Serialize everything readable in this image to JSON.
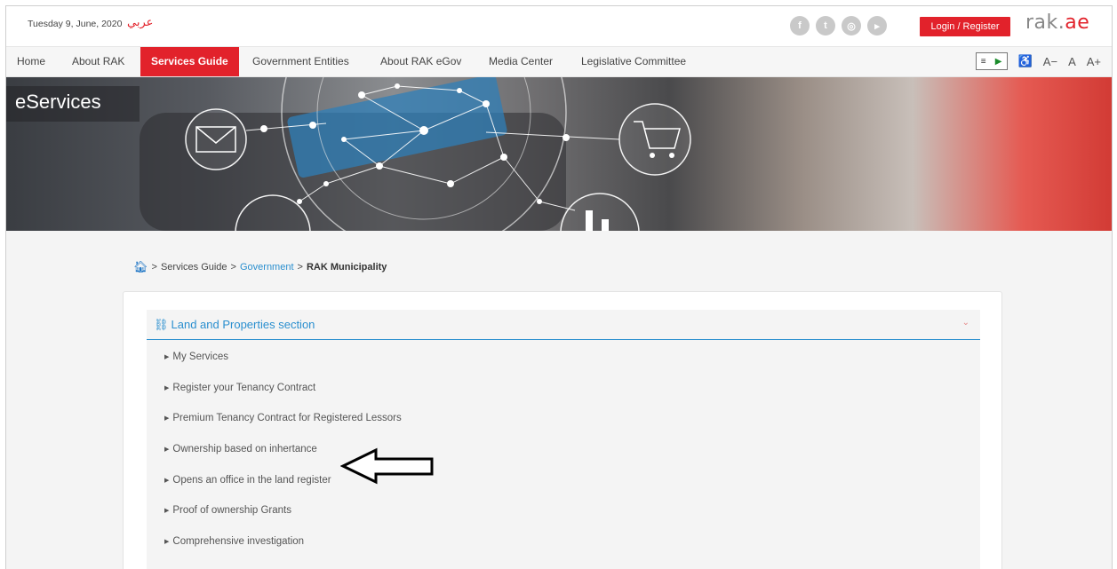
{
  "topbar": {
    "date": "Tuesday 9, June, 2020",
    "language_switch": "عربي",
    "social": [
      {
        "icon": "facebook-icon",
        "glyph": "f"
      },
      {
        "icon": "twitter-icon",
        "glyph": "t"
      },
      {
        "icon": "instagram-icon",
        "glyph": "◎"
      },
      {
        "icon": "youtube-icon",
        "glyph": "▸"
      }
    ],
    "login_label": "Login / Register",
    "brand_left": "rak.",
    "brand_right": "ae"
  },
  "nav": {
    "items": [
      "Home",
      "About RAK",
      "Services Guide",
      "Government Entities",
      "About RAK eGov",
      "Media Center",
      "Legislative Committee"
    ],
    "active_index": 2,
    "font_small": "A−",
    "font_normal": "A",
    "font_large": "A+"
  },
  "hero": {
    "title": "eServices"
  },
  "breadcrumb": {
    "sep": ">",
    "services_guide": "Services Guide",
    "government": "Government",
    "current": "RAK Municipality"
  },
  "section": {
    "title": "Land and Properties section",
    "items": [
      "My Services",
      "Register your Tenancy Contract",
      "Premium Tenancy Contract for Registered Lessors",
      "Ownership based on inhertance",
      "Opens an office in the land register",
      "Proof of ownership Grants",
      "Comprehensive investigation"
    ]
  },
  "colors": {
    "brand_red": "#e2222b",
    "link_blue": "#2a8fcf"
  }
}
